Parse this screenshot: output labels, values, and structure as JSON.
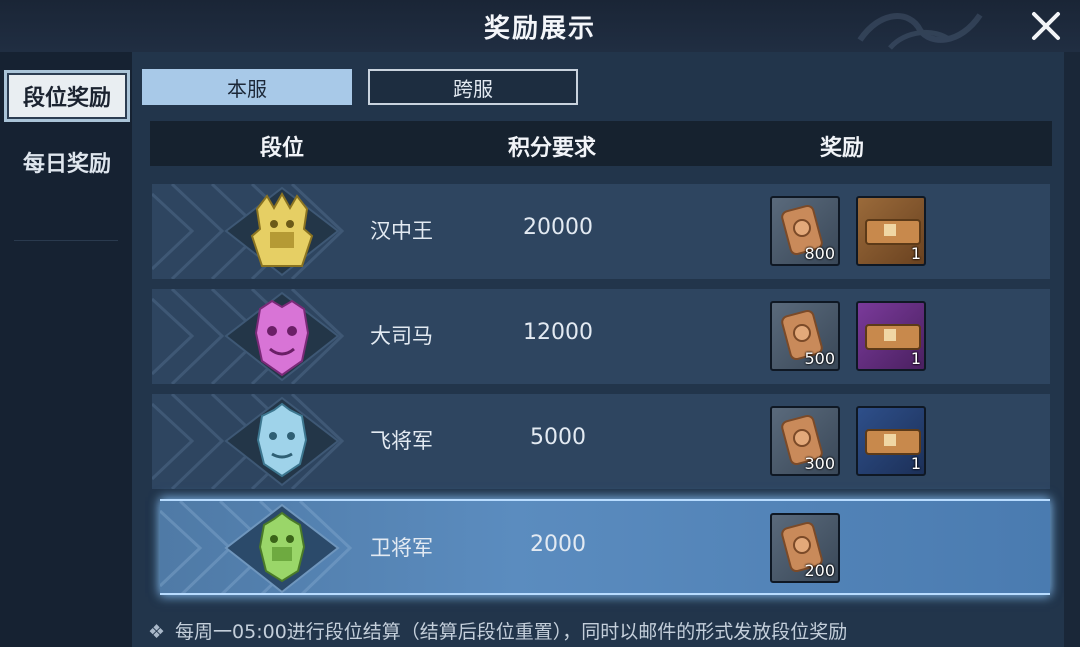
{
  "window": {
    "title": "奖励展示"
  },
  "sidebar": {
    "tabs": [
      {
        "label": "段位奖励",
        "active": true
      },
      {
        "label": "每日奖励",
        "active": false
      }
    ]
  },
  "server_tabs": [
    {
      "label": "本服",
      "active": true
    },
    {
      "label": "跨服",
      "active": false
    }
  ],
  "table": {
    "headers": {
      "rank": "段位",
      "score": "积分要求",
      "reward": "奖励"
    },
    "rows": [
      {
        "name": "汉中王",
        "score": "20000",
        "emblem_color": "#e9d36a",
        "rewards": [
          {
            "icon": "token-icon",
            "count": "800"
          },
          {
            "icon": "gold-chest-icon",
            "count": "1"
          }
        ]
      },
      {
        "name": "大司马",
        "score": "12000",
        "emblem_color": "#d87ad8",
        "rewards": [
          {
            "icon": "token-icon",
            "count": "500"
          },
          {
            "icon": "purple-chest-icon",
            "count": "1"
          }
        ]
      },
      {
        "name": "飞将军",
        "score": "5000",
        "emblem_color": "#9dd3ea",
        "rewards": [
          {
            "icon": "token-icon",
            "count": "300"
          },
          {
            "icon": "blue-chest-icon",
            "count": "1"
          }
        ]
      },
      {
        "name": "卫将军",
        "score": "2000",
        "emblem_color": "#9ad669",
        "highlight": true,
        "rewards": [
          {
            "icon": "token-icon",
            "count": "200"
          }
        ]
      }
    ]
  },
  "footer": {
    "note": "每周一05:00进行段位结算（结算后段位重置），同时以邮件的形式发放段位奖励"
  },
  "colors": {
    "accent_tab": "#a8c9e8",
    "highlight_row": "#5b8cbf"
  }
}
